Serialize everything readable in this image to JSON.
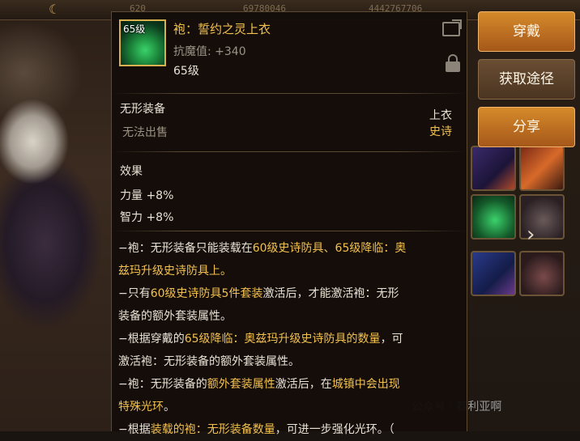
{
  "tooltip": {
    "icon_level_badge": "65级",
    "item_name": "袍：誓约之灵上衣",
    "stat_label": "抗魔值:",
    "stat_value": "+340",
    "item_level": "65级",
    "section_title": "无形装备",
    "trade_status": "无法出售",
    "slot_type": "上衣",
    "rarity": "史诗",
    "effects_title": "效果",
    "effects": [
      "力量 +8%",
      "智力 +8%"
    ],
    "description": [
      [
        {
          "t": "−袍：无形装备只能装载在",
          "c": ""
        },
        {
          "t": "60级史诗防具、65级降临：奥",
          "c": "gold"
        }
      ],
      [
        {
          "t": "兹玛升级史诗防具上。",
          "c": "gold"
        }
      ],
      [
        {
          "t": "−只有",
          "c": ""
        },
        {
          "t": "60级史诗防具5件套装",
          "c": "gold"
        },
        {
          "t": "激活后，才能激活袍：无形",
          "c": ""
        }
      ],
      [
        {
          "t": "装备的额外套装属性。",
          "c": ""
        }
      ],
      [
        {
          "t": "−根据穿戴的",
          "c": ""
        },
        {
          "t": "65级降临：奥兹玛升级史诗防具的数量",
          "c": "gold"
        },
        {
          "t": "，可",
          "c": ""
        }
      ],
      [
        {
          "t": "激活袍：无形装备的额外套装属性。",
          "c": ""
        }
      ],
      [
        {
          "t": "−袍：无形装备的",
          "c": ""
        },
        {
          "t": "额外套装属性",
          "c": "gold"
        },
        {
          "t": "激活后，在",
          "c": ""
        },
        {
          "t": "城镇中会出现",
          "c": "gold"
        }
      ],
      [
        {
          "t": "特殊光环",
          "c": "gold"
        },
        {
          "t": "。",
          "c": ""
        }
      ],
      [
        {
          "t": "−根据",
          "c": ""
        },
        {
          "t": "装载的袍：无形装备数量",
          "c": "gold"
        },
        {
          "t": "，可进一步强化光环。（",
          "c": ""
        }
      ]
    ]
  },
  "actions": {
    "wear_label": "穿戴",
    "source_label": "获取途径",
    "share_label": "分享"
  },
  "background": {
    "topbar_numbers": [
      "620",
      "69780046",
      "4442767706"
    ],
    "watermark": "公众号 · 赛利亚啊"
  }
}
